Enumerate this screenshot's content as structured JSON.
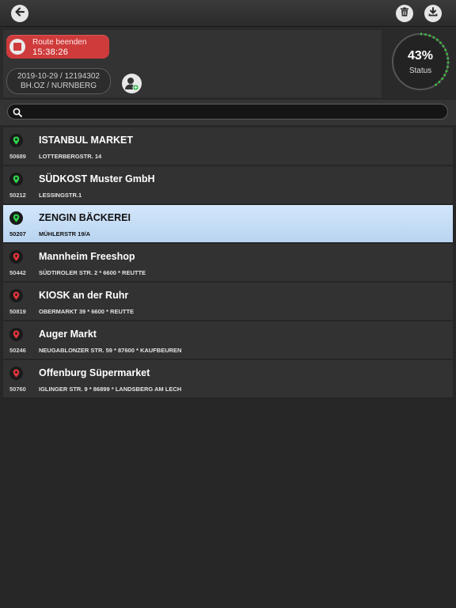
{
  "toolbar": {
    "back_icon": "arrow-left-icon",
    "trash_icon": "trash-icon",
    "download_icon": "download-icon"
  },
  "route": {
    "end_label": "Route beenden",
    "timer": "15:38:26",
    "date_id": "2019-10-29 / 12194302",
    "location": "BH.OZ / NURNBERG"
  },
  "status": {
    "percent": "43%",
    "label": "Status",
    "progress": 0.43,
    "ring_color": "#3ec43e"
  },
  "search": {
    "placeholder": ""
  },
  "colors": {
    "pin_visited": "#2fd14a",
    "pin_open": "#e0353b",
    "route_end": "#cf3b3b",
    "selected": "#c6ddf6"
  },
  "stops": [
    {
      "name": "ISTANBUL MARKET",
      "id": "50689",
      "address": "LOTTERBERGSTR. 14",
      "status": "green",
      "selected": false
    },
    {
      "name": "SÜDKOST Muster GmbH",
      "id": "50212",
      "address": "LESSINGSTR.1",
      "status": "green",
      "selected": false
    },
    {
      "name": "ZENGIN BÄCKEREI",
      "id": "50207",
      "address": "MÜHLERSTR 19/A",
      "status": "green",
      "selected": true
    },
    {
      "name": "Mannheim Freeshop",
      "id": "50442",
      "address": "SÜDTIROLER STR. 2 * 6600 * REUTTE",
      "status": "red",
      "selected": false
    },
    {
      "name": "KIOSK an der Ruhr",
      "id": "50819",
      "address": "OBERMARKT 39 * 6600 * REUTTE",
      "status": "red",
      "selected": false
    },
    {
      "name": "Auger Markt",
      "id": "50246",
      "address": "NEUGABLONZER STR. 59 * 87600 * KAUFBEUREN",
      "status": "red",
      "selected": false
    },
    {
      "name": "Offenburg Süpermarket",
      "id": "50760",
      "address": "IGLINGER STR. 9 * 86899 * LANDSBERG AM LECH",
      "status": "red",
      "selected": false
    }
  ]
}
